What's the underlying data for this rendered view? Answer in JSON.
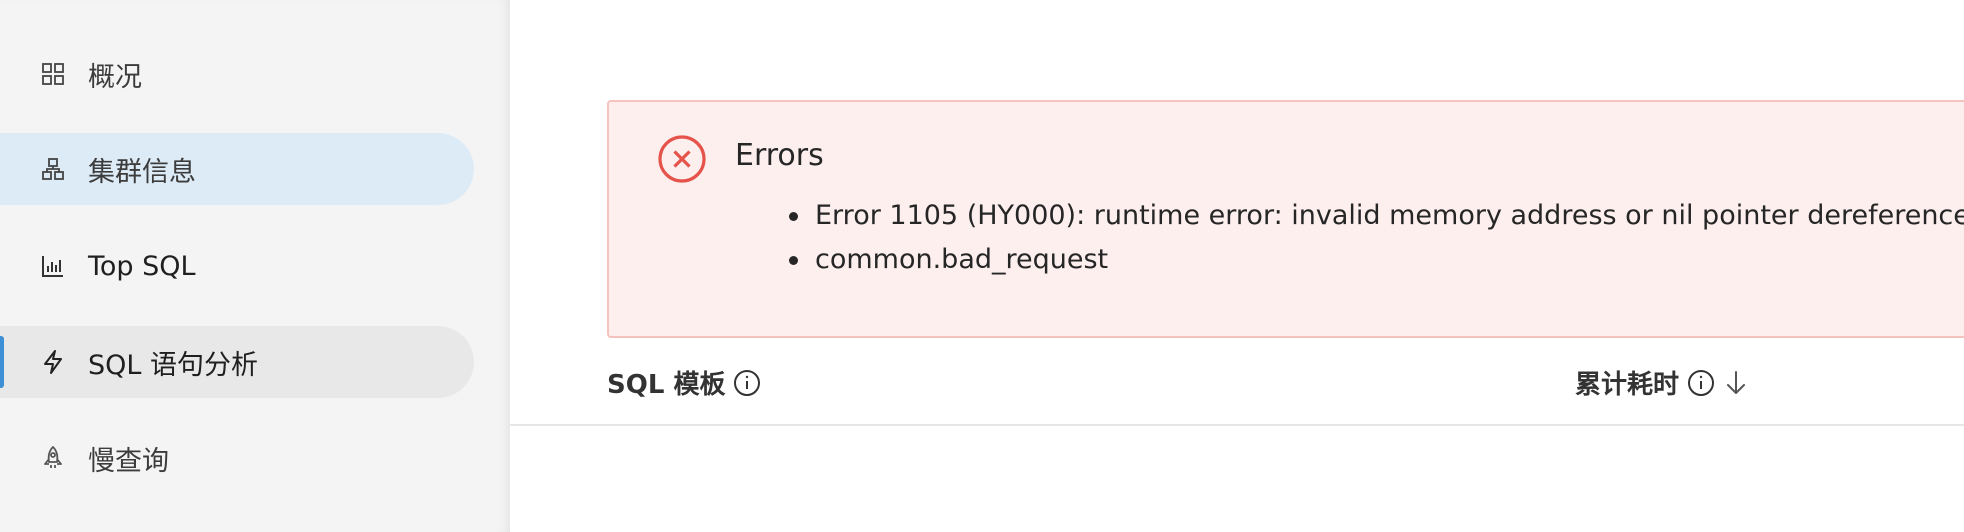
{
  "sidebar": {
    "items": [
      {
        "label": "概况",
        "icon": "dashboard-grid-icon"
      },
      {
        "label": "集群信息",
        "icon": "cluster-icon"
      },
      {
        "label": "Top SQL",
        "icon": "bar-chart-icon"
      },
      {
        "label": "SQL 语句分析",
        "icon": "lightning-icon"
      },
      {
        "label": "慢查询",
        "icon": "rocket-icon"
      }
    ]
  },
  "alert": {
    "title": "Errors",
    "messages": [
      "Error 1105 (HY000): runtime error: invalid memory address or nil pointer dereference",
      "common.bad_request"
    ]
  },
  "table": {
    "columns": [
      {
        "label": "SQL 模板"
      },
      {
        "label": "累计耗时"
      }
    ]
  },
  "colors": {
    "selected_bg": "#ddebf6",
    "accent": "#3d8fd6",
    "error": "#e5534b",
    "alert_bg": "#fcefee",
    "alert_border": "#f5c2bd"
  }
}
